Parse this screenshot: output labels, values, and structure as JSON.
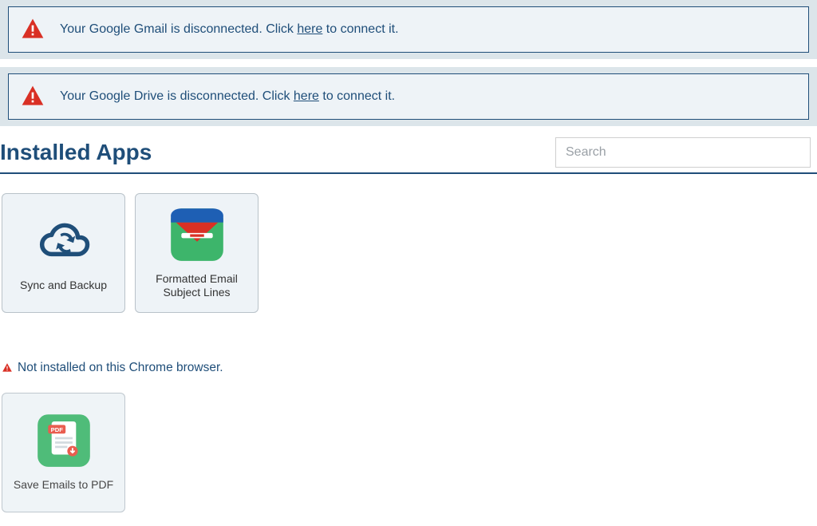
{
  "alerts": [
    {
      "prefix": "Your Google Gmail is disconnected. Click ",
      "link": "here",
      "suffix": " to connect it."
    },
    {
      "prefix": "Your Google Drive is disconnected. Click ",
      "link": "here",
      "suffix": " to connect it."
    }
  ],
  "header": {
    "title": "Installed Apps",
    "search_placeholder": "Search"
  },
  "apps": {
    "installed": [
      {
        "label": "Sync and Backup"
      },
      {
        "label": "Formatted Email Subject Lines"
      }
    ],
    "not_installed_label": "Not installed on this Chrome browser.",
    "not_installed": [
      {
        "label": "Save Emails to PDF"
      }
    ]
  },
  "colors": {
    "accent": "#1f4e79",
    "alert_bg": "#eef3f7",
    "alert_wrap": "#dce5ea",
    "warn_red": "#d93025"
  }
}
